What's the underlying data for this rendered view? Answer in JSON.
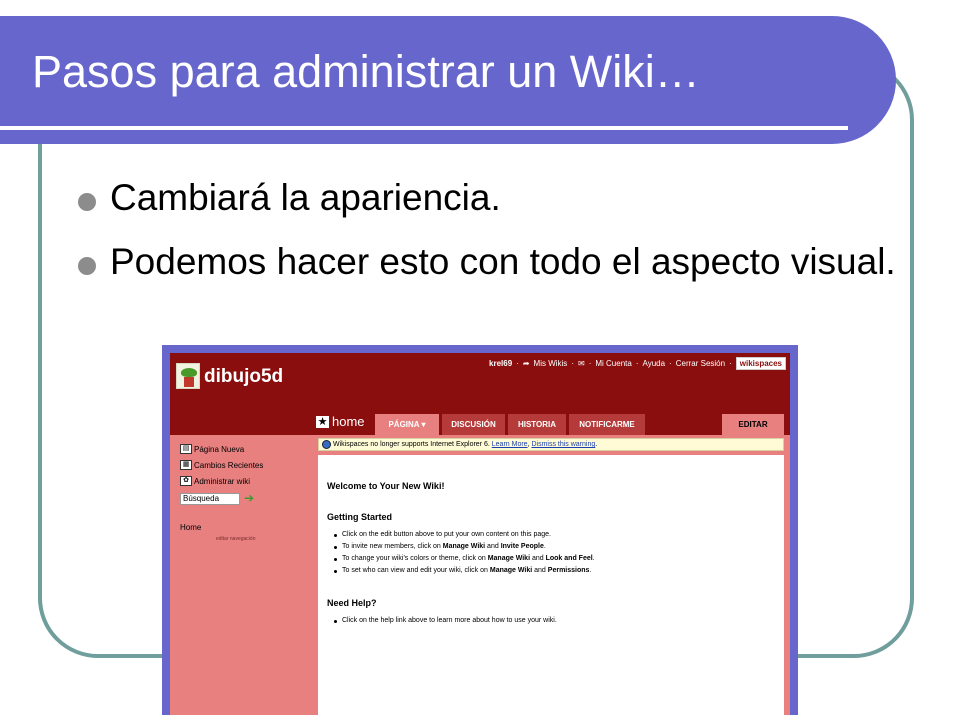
{
  "slide": {
    "title": "Pasos para administrar un Wiki…",
    "bullets": [
      "Cambiará la apariencia.",
      "Podemos hacer esto con todo el aspecto visual."
    ]
  },
  "colors": {
    "title_band": "#6666cc",
    "frame": "#6f9e9c",
    "wiki_header": "#8a0e0e",
    "wiki_sidebar": "#e88080",
    "tab": "#b53a3a"
  },
  "wiki": {
    "site_name": "dibujo5d",
    "top_links": {
      "user": "krel69",
      "my_wikis": "Mis Wikis",
      "my_account": "Mi Cuenta",
      "help": "Ayuda",
      "logout": "Cerrar Sesión",
      "brand": "wikispaces"
    },
    "home_tab": "home",
    "tabs": {
      "page": "PÁGINA",
      "discussion": "DISCUSIÓN",
      "history": "HISTORIA",
      "notify": "NOTIFICARME",
      "edit": "EDITAR"
    },
    "sidebar": {
      "new_page": "Página Nueva",
      "recent_changes": "Cambios Recientes",
      "manage_wiki": "Administrar wiki",
      "search_value": "Búsqueda",
      "home": "Home",
      "edit_nav": "editar navegación"
    },
    "notice": {
      "text": "Wikispaces no longer supports Internet Explorer 6.",
      "learn_more": "Learn More",
      "dismiss": "Dismiss this warning"
    },
    "content": {
      "welcome": "Welcome to Your New Wiki!",
      "getting_started": "Getting Started",
      "items": [
        {
          "pre": "Click on the edit button above to put your own content on this page.",
          "b1": "",
          "mid": "",
          "b2": "",
          "post": ""
        },
        {
          "pre": "To invite new members, click on ",
          "b1": "Manage Wiki",
          "mid": " and ",
          "b2": "Invite People",
          "post": "."
        },
        {
          "pre": "To change your wiki's colors or theme, click on ",
          "b1": "Manage Wiki",
          "mid": " and ",
          "b2": "Look and Feel",
          "post": "."
        },
        {
          "pre": "To set who can view and edit your wiki, click on ",
          "b1": "Manage Wiki",
          "mid": " and ",
          "b2": "Permissions",
          "post": "."
        }
      ],
      "need_help": "Need Help?",
      "help_item": "Click on the help link above to learn more about how to use your wiki."
    }
  }
}
